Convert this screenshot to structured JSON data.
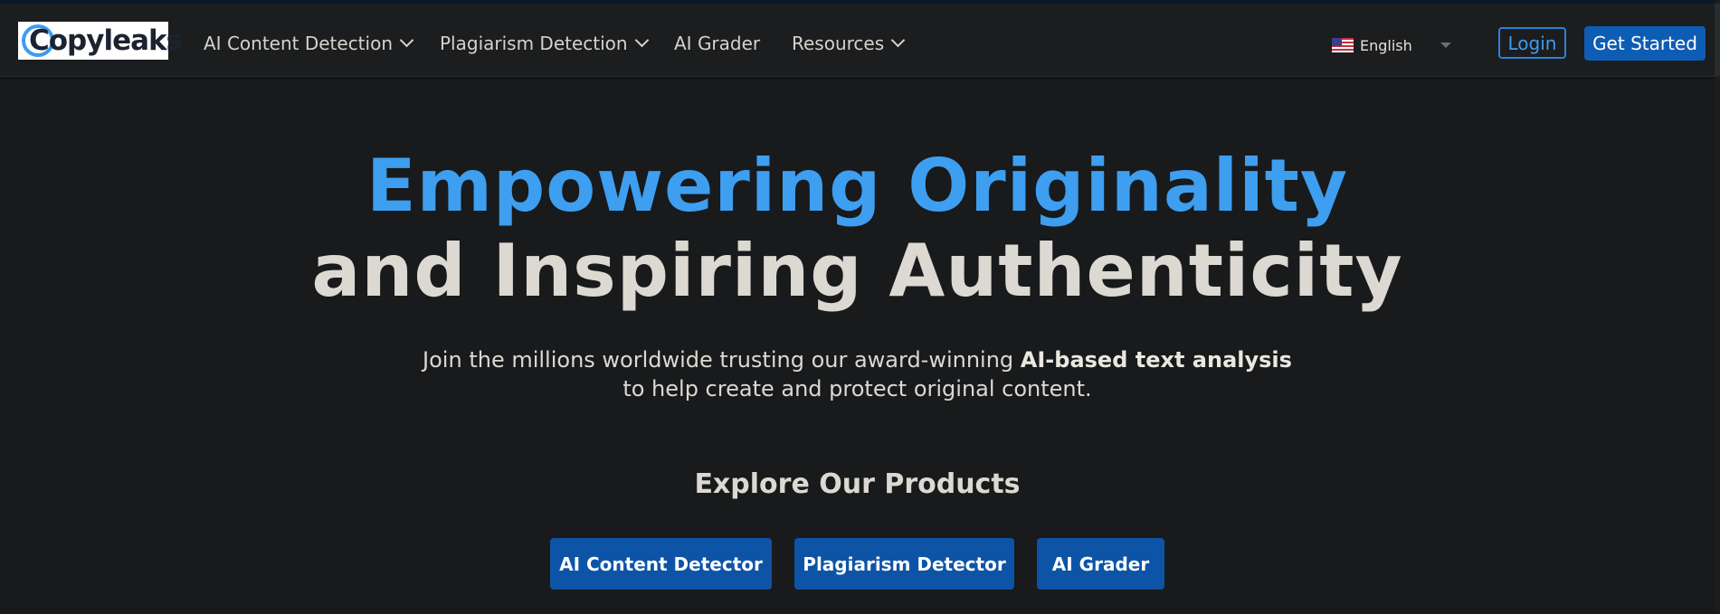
{
  "header": {
    "logo_text": "Copyleaks",
    "nav": [
      {
        "label": "AI Content Detection",
        "has_dropdown": true
      },
      {
        "label": "Plagiarism Detection",
        "has_dropdown": true
      },
      {
        "label": "AI Grader",
        "has_dropdown": false
      },
      {
        "label": "Resources",
        "has_dropdown": true
      }
    ],
    "language": {
      "selected": "English",
      "flag_icon": "us-flag-icon"
    },
    "login_label": "Login",
    "get_started_label": "Get Started"
  },
  "hero": {
    "title_line1": "Empowering Originality",
    "title_line2": "and Inspiring Authenticity",
    "subtitle_start": "Join the millions worldwide trusting our award-winning ",
    "subtitle_bold": "AI-based text analysis",
    "subtitle_end": "to help create and protect original content."
  },
  "products": {
    "heading": "Explore Our Products",
    "buttons": [
      {
        "label": "AI Content Detector"
      },
      {
        "label": "Plagiarism Detector"
      },
      {
        "label": "AI Grader"
      }
    ]
  },
  "colors": {
    "background": "#181a1b",
    "accent_blue": "#3e9ef0",
    "button_blue": "#0d54a6",
    "text_light": "#dcd8d2"
  }
}
